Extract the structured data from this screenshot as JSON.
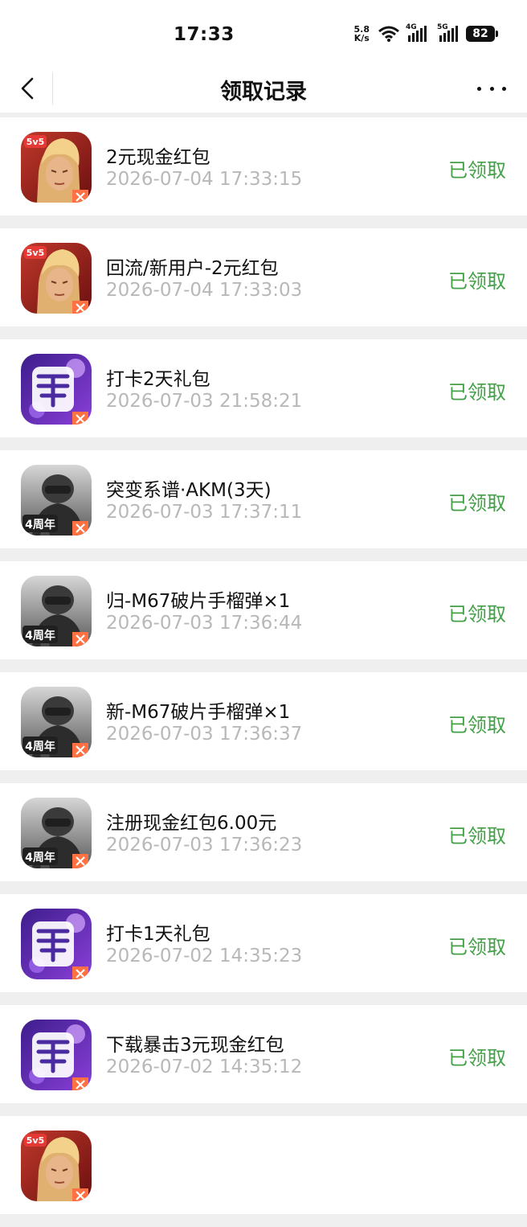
{
  "status_bar": {
    "time": "17:33",
    "net_speed_value": "5.8",
    "net_speed_unit": "K/s",
    "sim1_label": "4G",
    "sim2_label": "5G",
    "battery": "82"
  },
  "header": {
    "title": "领取记录"
  },
  "records": [
    {
      "title": "2元现金红包",
      "time": "2026-07-04 17:33:15",
      "status": "已领取",
      "icon": "hok-game-icon"
    },
    {
      "title": "回流/新用户-2元红包",
      "time": "2026-07-04 17:33:03",
      "status": "已领取",
      "icon": "hok-game-icon"
    },
    {
      "title": "打卡2天礼包",
      "time": "2026-07-03 21:58:21",
      "status": "已领取",
      "icon": "dance-game-icon"
    },
    {
      "title": "突变系谱·AKM(3天)",
      "time": "2026-07-03 17:37:11",
      "status": "已领取",
      "icon": "pubg-game-icon"
    },
    {
      "title": "归-M67破片手榴弹×1",
      "time": "2026-07-03 17:36:44",
      "status": "已领取",
      "icon": "pubg-game-icon"
    },
    {
      "title": "新-M67破片手榴弹×1",
      "time": "2026-07-03 17:36:37",
      "status": "已领取",
      "icon": "pubg-game-icon"
    },
    {
      "title": "注册现金红包6.00元",
      "time": "2026-07-03 17:36:23",
      "status": "已领取",
      "icon": "pubg-game-icon"
    },
    {
      "title": "打卡1天礼包",
      "time": "2026-07-02 14:35:23",
      "status": "已领取",
      "icon": "dance-game-icon"
    },
    {
      "title": "下载暴击3元现金红包",
      "time": "2026-07-02 14:35:12",
      "status": "已领取",
      "icon": "dance-game-icon"
    },
    {
      "title": "",
      "time": "",
      "status": "",
      "icon": "hok-game-icon"
    }
  ],
  "icon_badges": {
    "hok": "5v5",
    "pubg": "4周年"
  },
  "colors": {
    "status_green": "#43a047",
    "time_gray": "#b8b8b8",
    "separator_gray": "#efefef"
  }
}
